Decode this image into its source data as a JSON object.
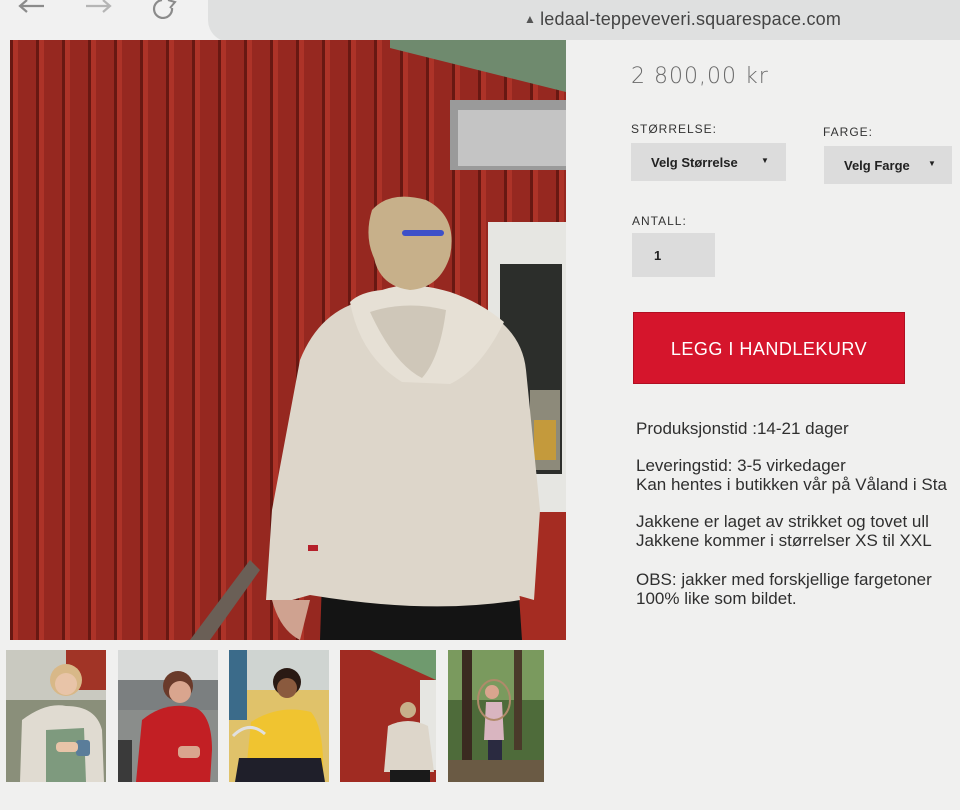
{
  "browser": {
    "url": "ledaal-teppeveveri.squarespace.com",
    "back_icon": "back-arrow-icon",
    "forward_icon": "forward-arrow-icon",
    "reload_icon": "reload-icon",
    "lock_icon": "lock-icon"
  },
  "product": {
    "price": "2 800,00 kr",
    "size_label": "STØRRELSE:",
    "size_select": "Velg Størrelse",
    "color_label": "FARGE:",
    "color_select": "Velg Farge",
    "quantity_label": "ANTALL:",
    "quantity_value": "1",
    "add_to_cart": "LEGG I HANDLEKURV",
    "description": [
      "Produksjonstid :14-21 dager",
      "Leveringstid: 3-5 virkedager",
      "Kan hentes i butikken vår på Våland i Sta",
      "Jakkene er laget av strikket og tovet ull",
      "Jakkene kommer i størrelser XS til XXL",
      "OBS: jakker med forskjellige fargetoner",
      "100% like som bildet."
    ]
  },
  "thumbnails": [
    "thumb-woman-white-jacket-cup",
    "thumb-woman-red-jacket",
    "thumb-woman-yellow-jacket",
    "thumb-woman-white-jacket-red-house",
    "thumb-person-forest"
  ],
  "colors": {
    "accent": "#d5152c",
    "barn_red": "#9d2a21",
    "select_bg": "#dcdcdc"
  }
}
